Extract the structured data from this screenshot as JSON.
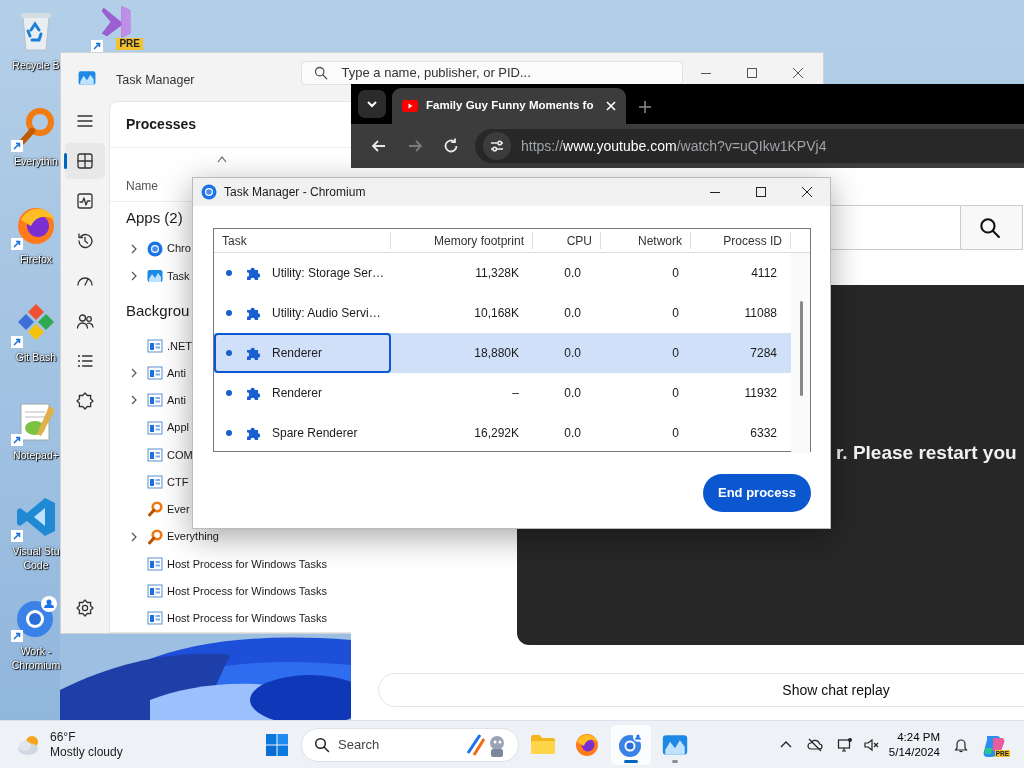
{
  "desktop_icons": [
    {
      "kind": "recycle-bin",
      "lines": [
        "Recycle B"
      ],
      "shortcut": false
    },
    {
      "kind": "visual-studio-preview",
      "badge": "PRE",
      "shortcut": true
    },
    {
      "kind": "everything",
      "lines": [
        "Everythin"
      ],
      "shortcut": true
    },
    {
      "kind": "firefox",
      "lines": [
        "Firefox"
      ],
      "shortcut": true
    },
    {
      "kind": "git-bash",
      "lines": [
        "Git Bash"
      ],
      "shortcut": true
    },
    {
      "kind": "notepad-plus-plus",
      "lines": [
        "Notepad+"
      ],
      "shortcut": true
    },
    {
      "kind": "vs-code",
      "lines": [
        "Visual Stu",
        "Code"
      ],
      "shortcut": true
    },
    {
      "kind": "chromium-profile",
      "lines": [
        "Work -",
        "Chromium"
      ],
      "shortcut": true
    }
  ],
  "task_manager": {
    "title": "Task Manager",
    "search": {
      "placeholder": "Type a name, publisher, or PID..."
    },
    "nav": [
      {
        "kind": "processes",
        "selected": true
      },
      {
        "kind": "performance",
        "selected": false
      },
      {
        "kind": "app-history",
        "selected": false
      },
      {
        "kind": "startup",
        "selected": false
      },
      {
        "kind": "users",
        "selected": false
      },
      {
        "kind": "details",
        "selected": false
      },
      {
        "kind": "services",
        "selected": false
      },
      {
        "kind": "settings",
        "selected": false
      }
    ],
    "page_title": "Processes",
    "name_column": "Name",
    "groups": [
      {
        "title": "Apps (2)",
        "children": [
          {
            "kind": "chromium",
            "label": "Chro",
            "expandable": true
          },
          {
            "kind": "task-manager",
            "label": "Task",
            "expandable": true
          }
        ]
      },
      {
        "title": "Backgrou",
        "children": [
          {
            "kind": "window",
            "label": ".NET",
            "expandable": false
          },
          {
            "kind": "window",
            "label": "Anti",
            "expandable": true
          },
          {
            "kind": "window",
            "label": "Anti",
            "expandable": true
          },
          {
            "kind": "window",
            "label": "Appl",
            "expandable": false
          },
          {
            "kind": "window",
            "label": "COM",
            "expandable": false
          },
          {
            "kind": "window",
            "label": "CTF",
            "expandable": false
          },
          {
            "kind": "everything",
            "label": "Ever",
            "expandable": false
          },
          {
            "kind": "everything",
            "label": "Everything",
            "expandable": true
          },
          {
            "kind": "window",
            "label": "Host Process for Windows Tasks",
            "expandable": false
          },
          {
            "kind": "window",
            "label": "Host Process for Windows Tasks",
            "expandable": false
          },
          {
            "kind": "window",
            "label": "Host Process for Windows Tasks",
            "expandable": false
          }
        ]
      }
    ]
  },
  "browser": {
    "tabs": [
      {
        "title": "Family Guy Funny Moments fo",
        "selected": true
      }
    ],
    "nav_buttons": [
      {
        "kind": "back",
        "disabled": false
      },
      {
        "kind": "forward",
        "disabled": true
      },
      {
        "kind": "reload",
        "disabled": false
      }
    ],
    "url": {
      "scheme": "https://",
      "host": "www.youtube.com",
      "path": "/watch?v=uQIkw1KPVj4"
    },
    "player_message": "r. Please restart you",
    "chat_button": "Show chat replay"
  },
  "chromium_task_manager": {
    "title": "Task Manager - Chromium",
    "columns": [
      "Task",
      "Memory footprint",
      "CPU",
      "Network",
      "Process ID"
    ],
    "rows": [
      {
        "task": "Utility: Storage Ser…",
        "memory": "11,328K",
        "cpu": "0.0",
        "network": "0",
        "pid": "4112",
        "selected": false,
        "focused": false
      },
      {
        "task": "Utility: Audio Servi…",
        "memory": "10,168K",
        "cpu": "0.0",
        "network": "0",
        "pid": "11088",
        "selected": false,
        "focused": false
      },
      {
        "task": "Renderer",
        "memory": "18,880K",
        "cpu": "0.0",
        "network": "0",
        "pid": "7284",
        "selected": true,
        "focused": true
      },
      {
        "task": "Renderer",
        "memory": "–",
        "cpu": "0.0",
        "network": "0",
        "pid": "11932",
        "selected": false,
        "focused": false
      },
      {
        "task": "Spare Renderer",
        "memory": "16,292K",
        "cpu": "0.0",
        "network": "0",
        "pid": "6332",
        "selected": false,
        "focused": false
      }
    ],
    "end_button": "End process"
  },
  "taskbar": {
    "weather": {
      "temp": "66°F",
      "condition": "Mostly cloudy"
    },
    "search": {
      "placeholder": "Search"
    },
    "apps": [
      {
        "kind": "file-explorer",
        "active": false,
        "running": false
      },
      {
        "kind": "firefox",
        "active": false,
        "running": false
      },
      {
        "kind": "chromium",
        "active": true,
        "running": true
      },
      {
        "kind": "task-manager",
        "active": false,
        "running": true
      }
    ],
    "clock": {
      "time": "4:24 PM",
      "date": "5/14/2024"
    },
    "copilot_badge": "PRE"
  }
}
